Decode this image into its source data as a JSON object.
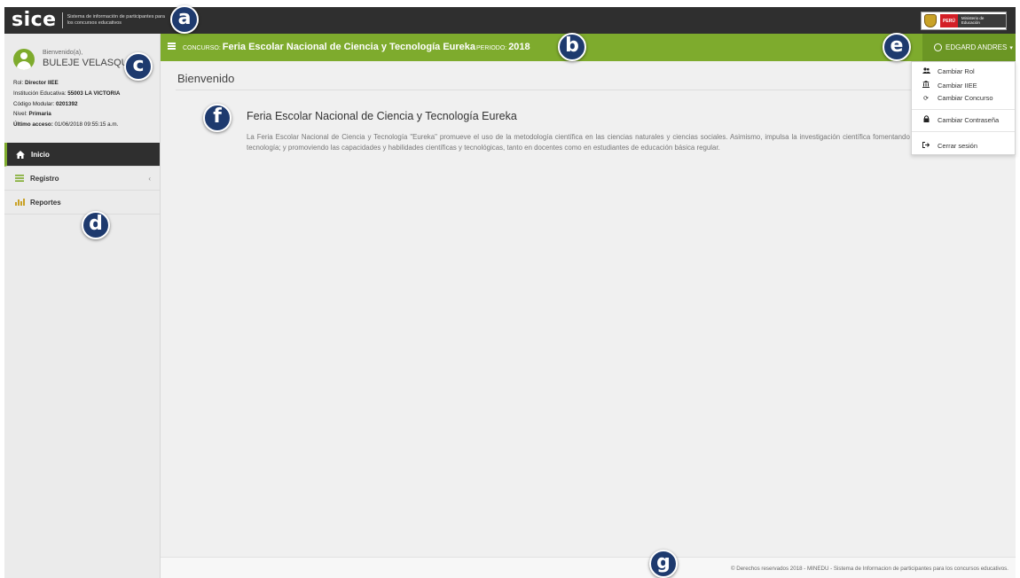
{
  "brand": {
    "logo": "sice",
    "tagline": "Sistema de información de participantes para los concursos educativos",
    "ministry_peru": "PERÚ",
    "ministry_name": "Ministerio de Educación"
  },
  "sidebar": {
    "welcome": "Bienvenido(a),",
    "username": "BULEJE VELASQUEZ",
    "info": [
      {
        "label": "Rol:",
        "value": "Director IIEE"
      },
      {
        "label": "Institución Educativa:",
        "value": "55003 LA VICTORIA"
      },
      {
        "label": "Código Modular:",
        "value": "0201392"
      },
      {
        "label": "Nivel:",
        "value": "Primaria"
      },
      {
        "label": "Último acceso:",
        "value": "01/06/2018 09:55:15 a.m."
      }
    ],
    "nav": [
      {
        "label": "Inicio",
        "icon": "home-icon"
      },
      {
        "label": "Registro",
        "icon": "list-icon",
        "chevron": "‹"
      },
      {
        "label": "Reportes",
        "icon": "bar-chart-icon"
      }
    ]
  },
  "header": {
    "concurso_label": "CONCURSO:",
    "concurso_value": "Feria Escolar Nacional de Ciencia y Tecnología Eureka",
    "periodo_label": "PERIODO:",
    "periodo_value": "2018",
    "user_menu_label": "EDGARD ANDRES"
  },
  "user_dropdown": [
    {
      "label": "Cambiar Rol",
      "icon": "users-icon"
    },
    {
      "label": "Cambiar IIEE",
      "icon": "institution-icon"
    },
    {
      "label": "Cambiar Concurso",
      "icon": "refresh-icon"
    },
    {
      "label": "Cambiar Contraseña",
      "icon": "lock-icon"
    },
    {
      "label": "Cerrar sesión",
      "icon": "sign-out-icon"
    }
  ],
  "main": {
    "page_title": "Bienvenido",
    "section_title": "Feria Escolar Nacional de Ciencia y Tecnología Eureka",
    "section_body": "La Feria Escolar Nacional de Ciencia y Tecnología \"Eureka\" promueve el uso de la metodología científica en las ciencias naturales y ciencias sociales. Asimismo, impulsa la investigación científica fomentando la pasión por la ciencia y la tecnología; y promoviendo las capacidades y habilidades científicas y tecnológicas, tanto en docentes como en estudiantes de educación básica regular."
  },
  "footer": {
    "text": "© Derechos reservados 2018 - MINEDU - Sistema de Informacion de participantes para los concursos educativos."
  },
  "markers": [
    "a",
    "b",
    "c",
    "d",
    "e",
    "f",
    "g"
  ],
  "colors": {
    "accent_green": "#7eab2d",
    "topbar_dark": "#2f2f2f",
    "marker_navy": "#1e3a6e"
  }
}
